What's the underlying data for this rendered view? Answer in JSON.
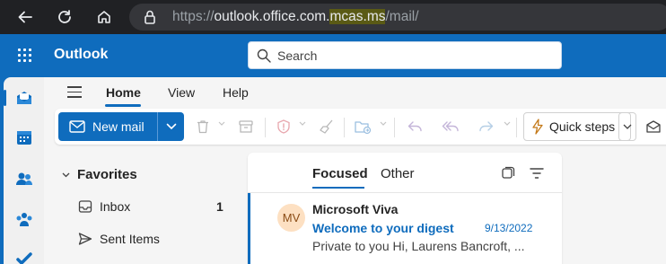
{
  "browser": {
    "url_prefix": "https://",
    "url_domain": "outlook.office.com.",
    "url_highlight": "mcas.ms",
    "url_path": "/mail/"
  },
  "header": {
    "app_title": "Outlook",
    "search_placeholder": "Search"
  },
  "tabs": [
    {
      "label": "Home",
      "active": true
    },
    {
      "label": "View",
      "active": false
    },
    {
      "label": "Help",
      "active": false
    }
  ],
  "ribbon": {
    "new_mail_label": "New mail",
    "quick_steps_label": "Quick steps"
  },
  "folders": {
    "favorites_label": "Favorites",
    "items": [
      {
        "label": "Inbox",
        "count": "1",
        "icon": "inbox-icon"
      },
      {
        "label": "Sent Items",
        "count": "",
        "icon": "send-icon"
      }
    ]
  },
  "message_list": {
    "tabs": [
      {
        "label": "Focused",
        "active": true
      },
      {
        "label": "Other",
        "active": false
      }
    ],
    "messages": [
      {
        "initials": "MV",
        "sender": "Microsoft Viva",
        "subject": "Welcome to your digest",
        "date": "9/13/2022",
        "preview": "Private to you Hi, Laurens Bancroft, ..."
      }
    ]
  },
  "colors": {
    "brand": "#0f6cbd",
    "chrome": "#202124",
    "url_highlight": "#5a5a15",
    "avatar_bg": "#fde0c2"
  }
}
